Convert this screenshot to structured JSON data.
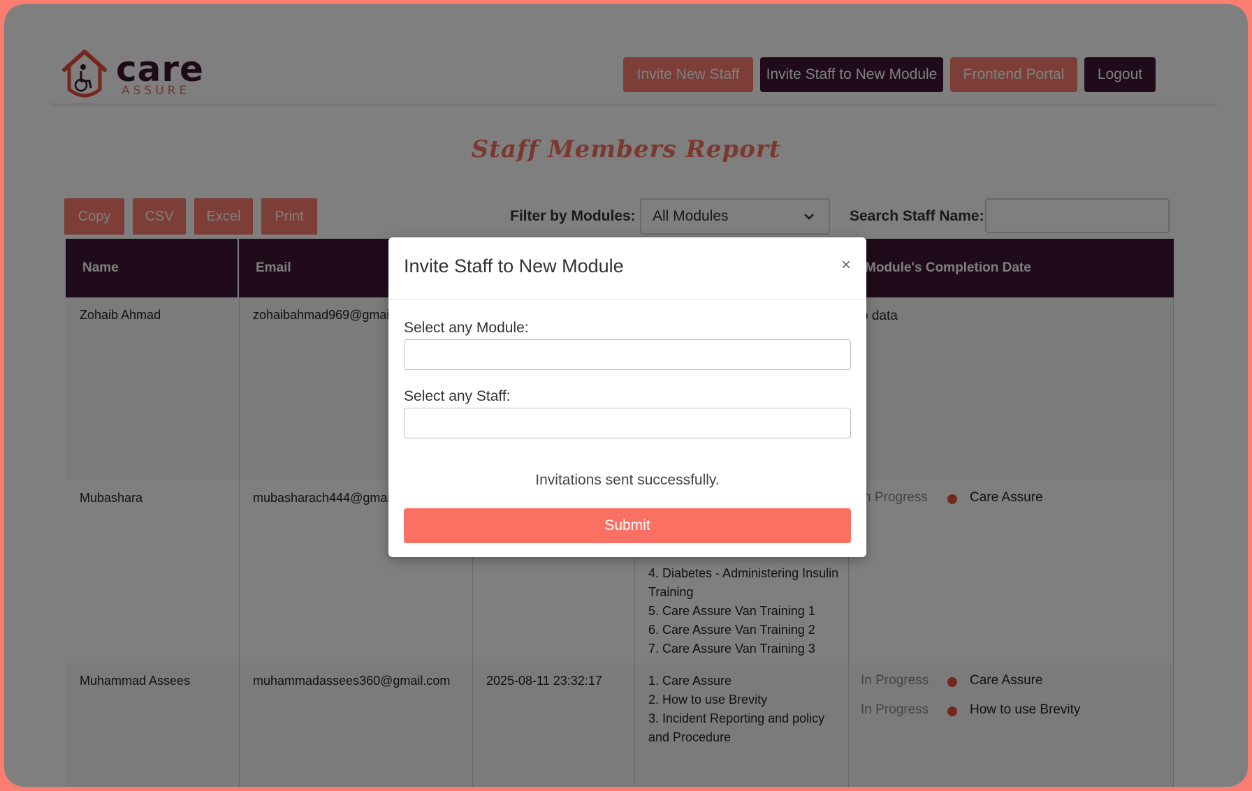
{
  "brand": {
    "name_main": "care",
    "name_sub": "ASSURE"
  },
  "nav": {
    "invite_new_staff": "Invite New Staff",
    "invite_staff_module": "Invite Staff to New Module",
    "frontend_portal": "Frontend Portal",
    "logout": "Logout"
  },
  "page_title": "Staff Members Report",
  "toolbar": {
    "copy": "Copy",
    "csv": "CSV",
    "excel": "Excel",
    "print": "Print"
  },
  "filter": {
    "label": "Filter by Modules:",
    "selected": "All Modules"
  },
  "search": {
    "label": "Search Staff Name:",
    "value": ""
  },
  "table": {
    "headers": [
      "Name",
      "Email",
      "",
      "",
      "Module's Completion Date"
    ],
    "rows": [
      {
        "name": "Zohaib Ahmad",
        "email": "zohaibahmad969@gmail.",
        "completion": "o data"
      },
      {
        "name": "Mubashara",
        "email": "mubasharach444@gmail.",
        "modules": [
          "4. Diabetes - Administering Insulin",
          "Training",
          "5. Care Assure Van Training 1",
          "6. Care Assure Van Training 2",
          "7. Care Assure Van Training 3"
        ],
        "status_items": [
          {
            "status": "n Progress",
            "module": "Care Assure"
          }
        ]
      },
      {
        "name": "Muhammad Assees",
        "email": "muhammadassees360@gmail.com",
        "date": "2025-08-11 23:32:17",
        "modules": [
          "1. Care Assure",
          "2. How to use Brevity",
          "3. Incident Reporting and policy",
          "and Procedure"
        ],
        "status_items": [
          {
            "status": "In Progress",
            "module": "Care Assure"
          },
          {
            "status": "In Progress",
            "module": "How to use Brevity"
          }
        ]
      }
    ]
  },
  "modal": {
    "title": "Invite Staff to New Module",
    "close": "×",
    "module_label": "Select any Module:",
    "staff_label": "Select any Staff:",
    "success_message": "Invitations sent successfully.",
    "submit": "Submit"
  },
  "colors": {
    "accent": "#fa7d6f",
    "brand_dark": "#3f1735",
    "status_dot": "#e94e3c"
  }
}
